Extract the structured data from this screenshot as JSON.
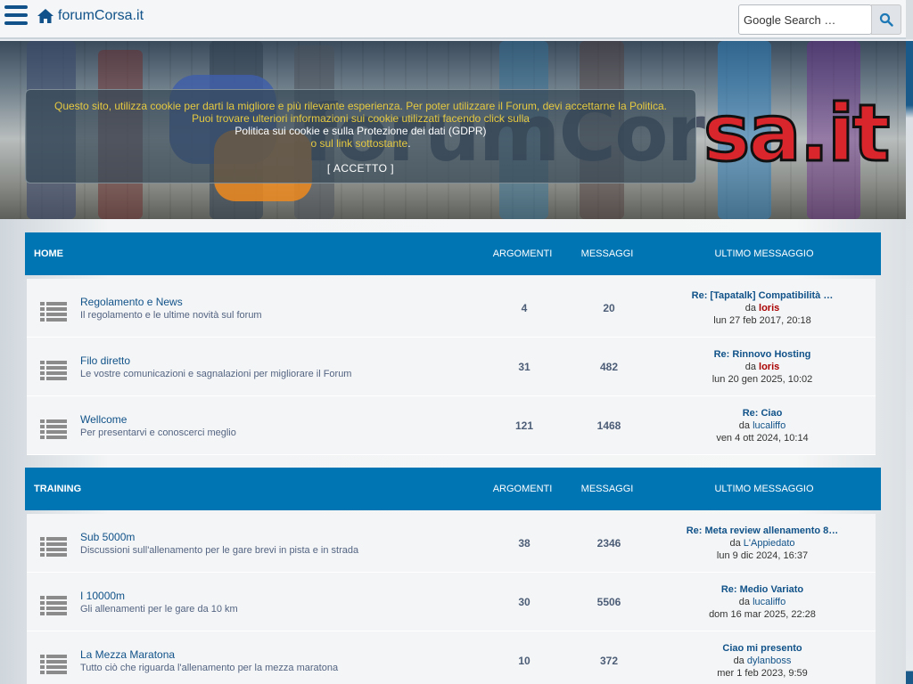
{
  "header": {
    "site_name": "forumCorsa.it",
    "search_placeholder": "Google Search …"
  },
  "banner": {
    "logo_text_a": "forumCor",
    "logo_text_b": "sa.it"
  },
  "cookie_notice": {
    "line1": "Questo sito, utilizza cookie per darti la migliore e più rilevante esperienza. Per poter utilizzare il Forum, devi accettarne la Politica.",
    "line2": "Puoi trovare ulteriori informazioni sui cookie utilizzati facendo click sulla",
    "line3": "Politica sui cookie e sulla Protezione dei dati (GDPR)",
    "line4": "o sul link sottostante",
    "line4_end": ".",
    "accept": "[ ACCETTO ]"
  },
  "columns": {
    "topics": "ARGOMENTI",
    "posts": "MESSAGGI",
    "last_post": "ULTIMO MESSAGGIO"
  },
  "categories": [
    {
      "title": "HOME",
      "forums": [
        {
          "name": "Regolamento e News",
          "desc": "Il regolamento e le ultime novità sul forum",
          "topics": "4",
          "posts": "20",
          "last_topic": "Re: [Tapatalk] Compatibilità …",
          "by": "da",
          "author": "loris",
          "date": "lun 27 feb 2017, 20:18"
        },
        {
          "name": "Filo diretto",
          "desc": "Le vostre comunicazioni e sagnalazioni per migliorare il Forum",
          "topics": "31",
          "posts": "482",
          "last_topic": "Re: Rinnovo Hosting",
          "by": "da",
          "author": "loris",
          "date": "lun 20 gen 2025, 10:02"
        },
        {
          "name": "Wellcome",
          "desc": "Per presentarvi e conoscerci meglio",
          "topics": "121",
          "posts": "1468",
          "last_topic": "Re: Ciao",
          "by": "da",
          "author": "lucaliffo",
          "date": "ven 4 ott 2024, 10:14"
        }
      ]
    },
    {
      "title": "TRAINING",
      "forums": [
        {
          "name": "Sub 5000m",
          "desc": "Discussioni sull'allenamento per le gare brevi in pista e in strada",
          "topics": "38",
          "posts": "2346",
          "last_topic": "Re: Meta review allenamento 8…",
          "by": "da",
          "author": "L'Appiedato",
          "date": "lun 9 dic 2024, 16:37"
        },
        {
          "name": "I 10000m",
          "desc": "Gli allenamenti per le gare da 10 km",
          "topics": "30",
          "posts": "5506",
          "last_topic": "Re: Medio Variato",
          "by": "da",
          "author": "lucaliffo",
          "date": "dom 16 mar 2025, 22:28"
        },
        {
          "name": "La Mezza Maratona",
          "desc": "Tutto ciò che riguarda l'allenamento per la mezza maratona",
          "topics": "10",
          "posts": "372",
          "last_topic": "Ciao mi presento",
          "by": "da",
          "author": "dylanboss",
          "date": "mer 1 feb 2023, 9:59"
        }
      ]
    }
  ],
  "colors": {
    "header_blue": "#0075b4",
    "link_blue": "#105289",
    "admin_red": "#aa0000"
  }
}
